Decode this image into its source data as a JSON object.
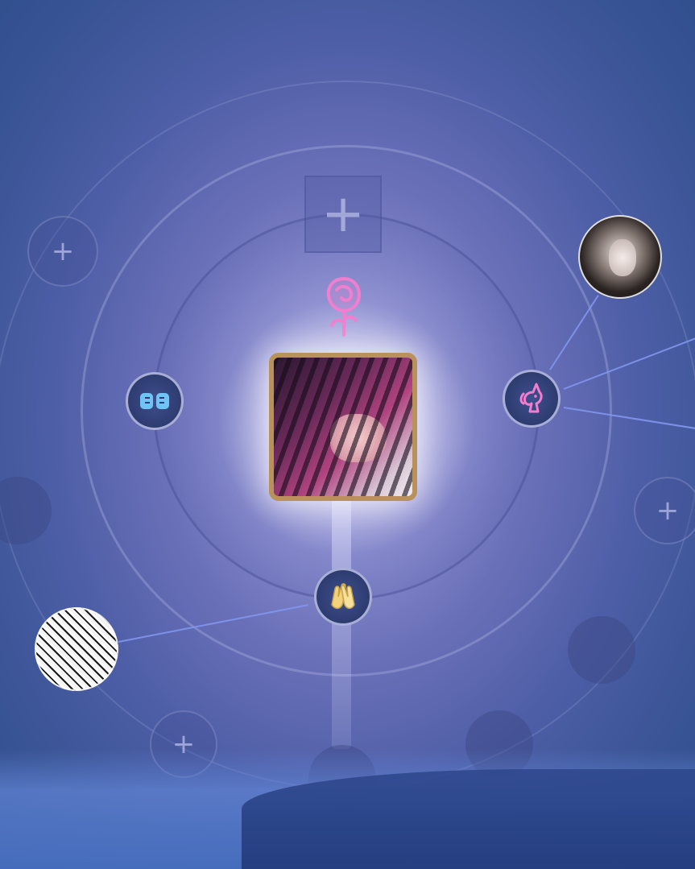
{
  "scene": {
    "name": "friend-constellation",
    "colors": {
      "background": "#4d5ea6",
      "frame": "#b8925a",
      "link_line": "#8296f0",
      "pink_glyph": "#f07fcf",
      "blue_glyph": "#6fc4f5",
      "gold_glyph": "#f2d27a"
    }
  },
  "center": {
    "avatar": "main-player-avatar",
    "badge_icon": "rose-icon"
  },
  "emblems": [
    {
      "name": "fist-bump-emblem",
      "icon": "fist-bump-icon"
    },
    {
      "name": "unicorn-emblem",
      "icon": "unicorn-icon"
    },
    {
      "name": "clapping-hands-emblem",
      "icon": "clapping-hands-icon"
    }
  ],
  "slots": {
    "add_symbol": "+",
    "top_add": "+",
    "left_upper": "+",
    "right_middle": "+",
    "bottom_left": "+"
  },
  "friends": [
    {
      "name": "friend-avatar-top-right"
    },
    {
      "name": "friend-avatar-bottom-left"
    }
  ]
}
